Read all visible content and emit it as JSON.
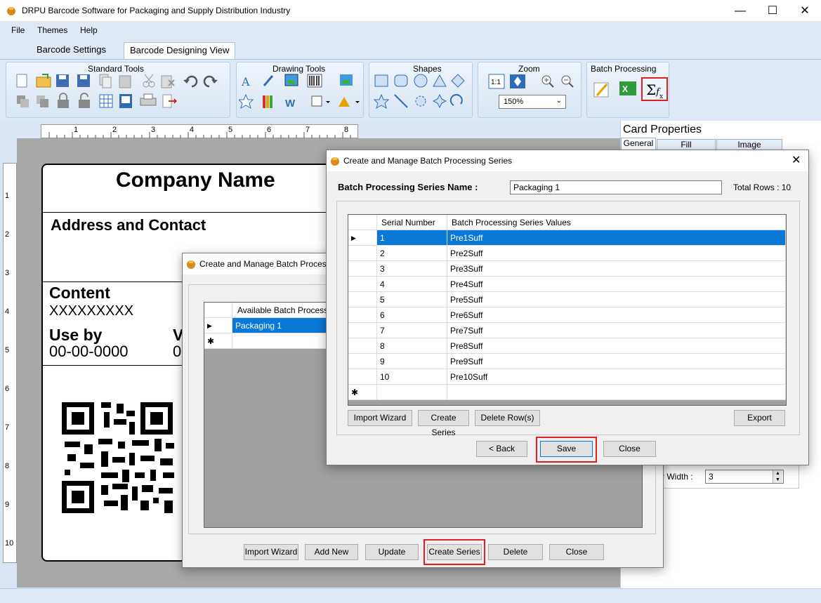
{
  "window": {
    "title": "DRPU Barcode Software for Packaging and Supply Distribution Industry"
  },
  "menu": [
    "File",
    "Themes",
    "Help"
  ],
  "tabs": [
    "Barcode Settings",
    "Barcode Designing View"
  ],
  "ribbon": {
    "groups": [
      "Standard Tools",
      "Drawing Tools",
      "Shapes",
      "Zoom",
      "Batch Processing"
    ],
    "zoom_value": "150%"
  },
  "rulers": {
    "h": [
      "1",
      "2",
      "3",
      "4",
      "5",
      "6",
      "7",
      "8"
    ],
    "v": [
      "1",
      "2",
      "3",
      "4",
      "5",
      "6",
      "7",
      "8",
      "9",
      "10"
    ]
  },
  "card": {
    "company": "Company Name",
    "address": "Address and Contact",
    "content_label": "Content",
    "content_value": "XXXXXXXXX",
    "useby_label": "Use by",
    "useby_value": "00-00-0000",
    "v_label": "V",
    "v_value": "0"
  },
  "props": {
    "title": "Card Properties",
    "tabs": [
      "General",
      "Fill Background",
      "Image Processing"
    ],
    "width_label": "r Width :",
    "width_value": "3"
  },
  "dialog_back": {
    "title": "Create and Manage Batch Process",
    "col_header": "Available Batch Processing",
    "rows": [
      "Packaging 1"
    ],
    "buttons": [
      "Import Wizard",
      "Add New",
      "Update",
      "Create Series",
      "Delete",
      "Close"
    ]
  },
  "dialog_front": {
    "title": "Create and Manage Batch Processing Series",
    "name_label": "Batch Processing Series Name :",
    "name_value": "Packaging 1",
    "total_rows": "Total Rows : 10",
    "col_serial": "Serial Number",
    "col_values": "Batch Processing Series Values",
    "rows": [
      {
        "serial": "1",
        "value": "Pre1Suff"
      },
      {
        "serial": "2",
        "value": "Pre2Suff"
      },
      {
        "serial": "3",
        "value": "Pre3Suff"
      },
      {
        "serial": "4",
        "value": "Pre4Suff"
      },
      {
        "serial": "5",
        "value": "Pre5Suff"
      },
      {
        "serial": "6",
        "value": "Pre6Suff"
      },
      {
        "serial": "7",
        "value": "Pre7Suff"
      },
      {
        "serial": "8",
        "value": "Pre8Suff"
      },
      {
        "serial": "9",
        "value": "Pre9Suff"
      },
      {
        "serial": "10",
        "value": "Pre10Suff"
      }
    ],
    "buttons": {
      "import": "Import Wizard",
      "create": "Create Series",
      "delete": "Delete Row(s)",
      "export": "Export",
      "back": "< Back",
      "save": "Save",
      "close": "Close"
    }
  },
  "colors": {
    "highlight": "#0a78d7",
    "accent_red": "#e02020"
  }
}
